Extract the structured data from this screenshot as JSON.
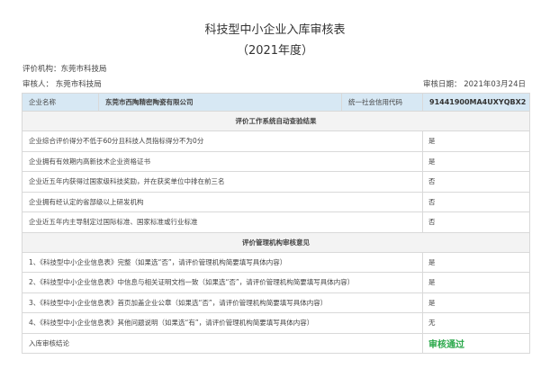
{
  "header": {
    "title": "科技型中小企业入库审核表",
    "subtitle": "（2021年度）",
    "org_label": "评价机构：东莞市科技局",
    "reviewer_label": "审核人：  东莞市科技局",
    "date_label": "审核日期：  2021年03月24日"
  },
  "company": {
    "name_label": "企业名称",
    "name_value": "东莞市西陶精密陶瓷有限公司",
    "credit_label": "统一社会信用代码",
    "credit_value": "91441900MA4UXYQBX2"
  },
  "section1": {
    "title": "评价工作系统自动查验结果",
    "rows": [
      {
        "item": "企业综合评价得分不低于60分且科技人员指标得分不为0分",
        "value": "是"
      },
      {
        "item": "企业拥有有效期内高新技术企业资格证书",
        "value": "是"
      },
      {
        "item": "企业近五年内获得过国家级科技奖励，并在获奖单位中排在前三名",
        "value": "否"
      },
      {
        "item": "企业拥有经认定的省部级以上研发机构",
        "value": "否"
      },
      {
        "item": "企业近五年内主导制定过国际标准、国家标准或行业标准",
        "value": "否"
      }
    ]
  },
  "section2": {
    "title": "评价管理机构审核意见",
    "rows": [
      {
        "item": "1、《科技型中小企业信息表》完整（如果选“否”，请评价管理机构简要填写具体内容）",
        "value": "是"
      },
      {
        "item": "2、《科技型中小企业信息表》中信息与相关证明文档一致（如果选“否”，请评价管理机构简要填写具体内容）",
        "value": "是"
      },
      {
        "item": "3、《科技型中小企业信息表》首页加盖企业公章（如果选“否”，请评价管理机构简要填写具体内容）",
        "value": "是"
      },
      {
        "item": "4、《科技型中小企业信息表》其他问题说明（如果选“有”，请评价管理机构简要填写具体内容）",
        "value": "无"
      }
    ]
  },
  "conclusion": {
    "label": "入库审核结论",
    "value": "审核通过"
  }
}
